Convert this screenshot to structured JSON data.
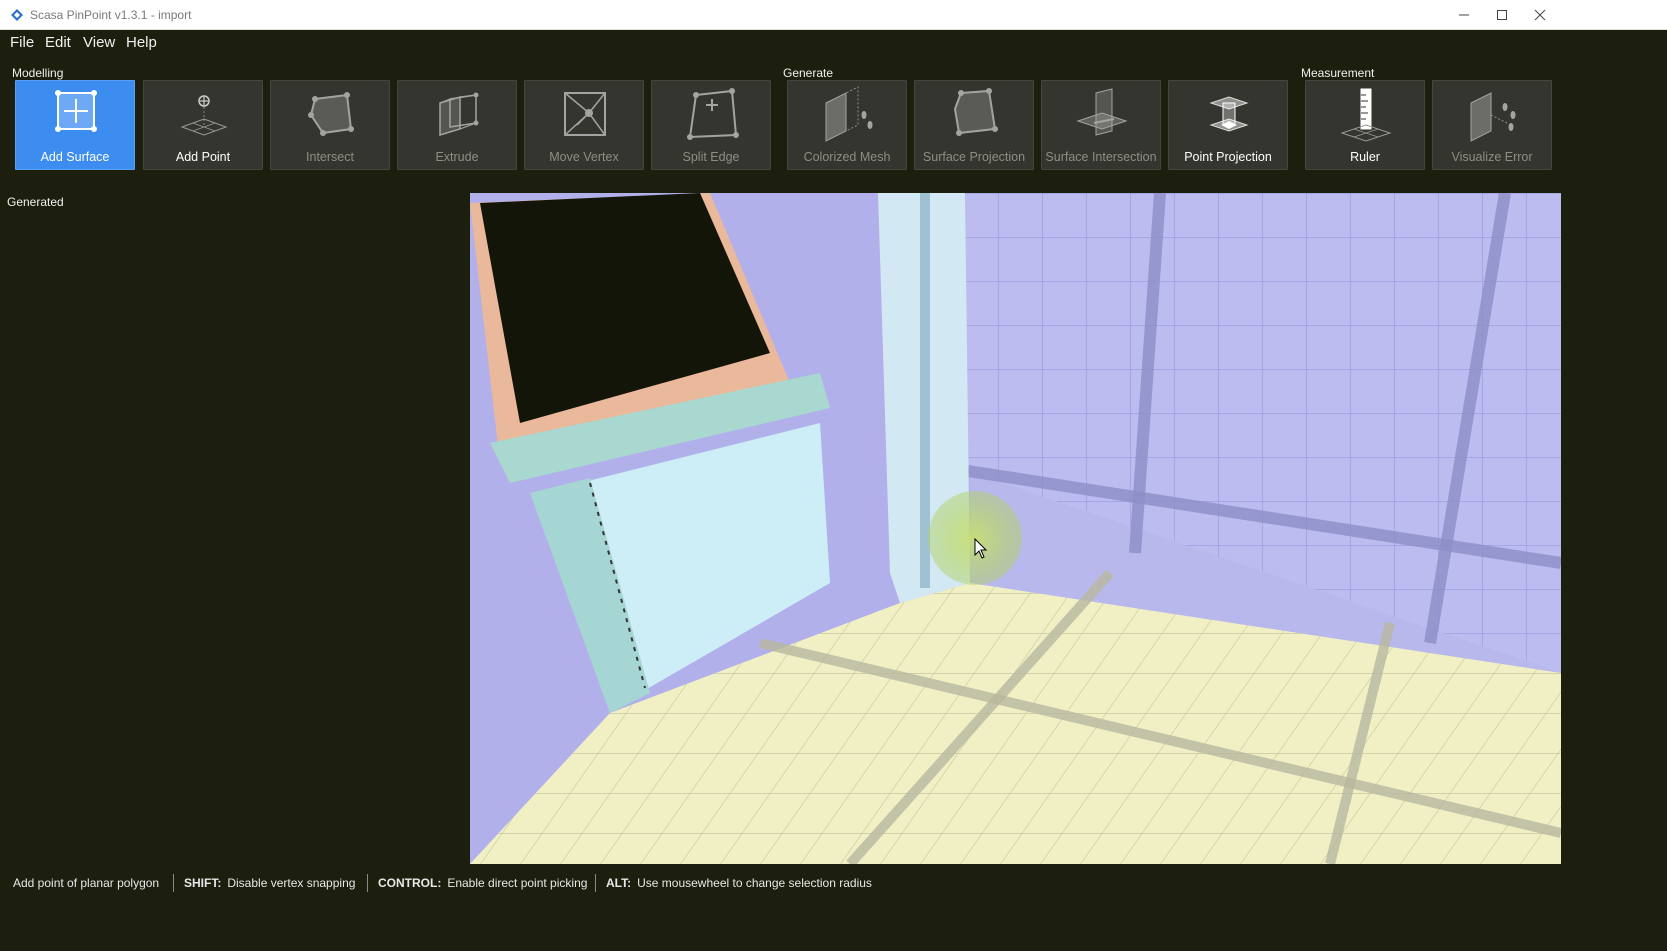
{
  "window": {
    "title": "Scasa PinPoint v1.3.1 - import",
    "minimize_label": "—",
    "maximize_label": "☐",
    "close_label": "✕"
  },
  "menu": [
    "File",
    "Edit",
    "View",
    "Help"
  ],
  "toolbar": {
    "groups": {
      "modelling": "Modelling",
      "generate": "Generate",
      "measurement": "Measurement"
    },
    "tools": {
      "add_surface": "Add Surface",
      "add_point": "Add Point",
      "intersect": "Intersect",
      "extrude": "Extrude",
      "move_vertex": "Move Vertex",
      "split_edge": "Split Edge",
      "colorized_mesh": "Colorized Mesh",
      "surface_projection": "Surface Projection",
      "surface_intersection": "Surface Intersection",
      "point_projection": "Point Projection",
      "ruler": "Ruler",
      "visualize_error": "Visualize Error"
    },
    "active_tool": "add_surface",
    "disabled_tools": [
      "intersect",
      "extrude",
      "move_vertex",
      "split_edge",
      "colorized_mesh",
      "surface_projection",
      "surface_intersection",
      "visualize_error"
    ],
    "accent_color": "#3d8cf0"
  },
  "panel": {
    "generated_label": "Generated"
  },
  "status": {
    "hint": "Add point of planar polygon",
    "shift_key": "SHIFT:",
    "shift_desc": "Disable vertex snapping",
    "control_key": "CONTROL:",
    "control_desc": "Enable direct point picking",
    "alt_key": "ALT:",
    "alt_desc": "Use mousewheel to change selection radius"
  },
  "colors": {
    "background": "#1d1f0e",
    "tool_button": "#34352e",
    "wall": "#b8b8ec",
    "floor": "#eeeec0"
  }
}
